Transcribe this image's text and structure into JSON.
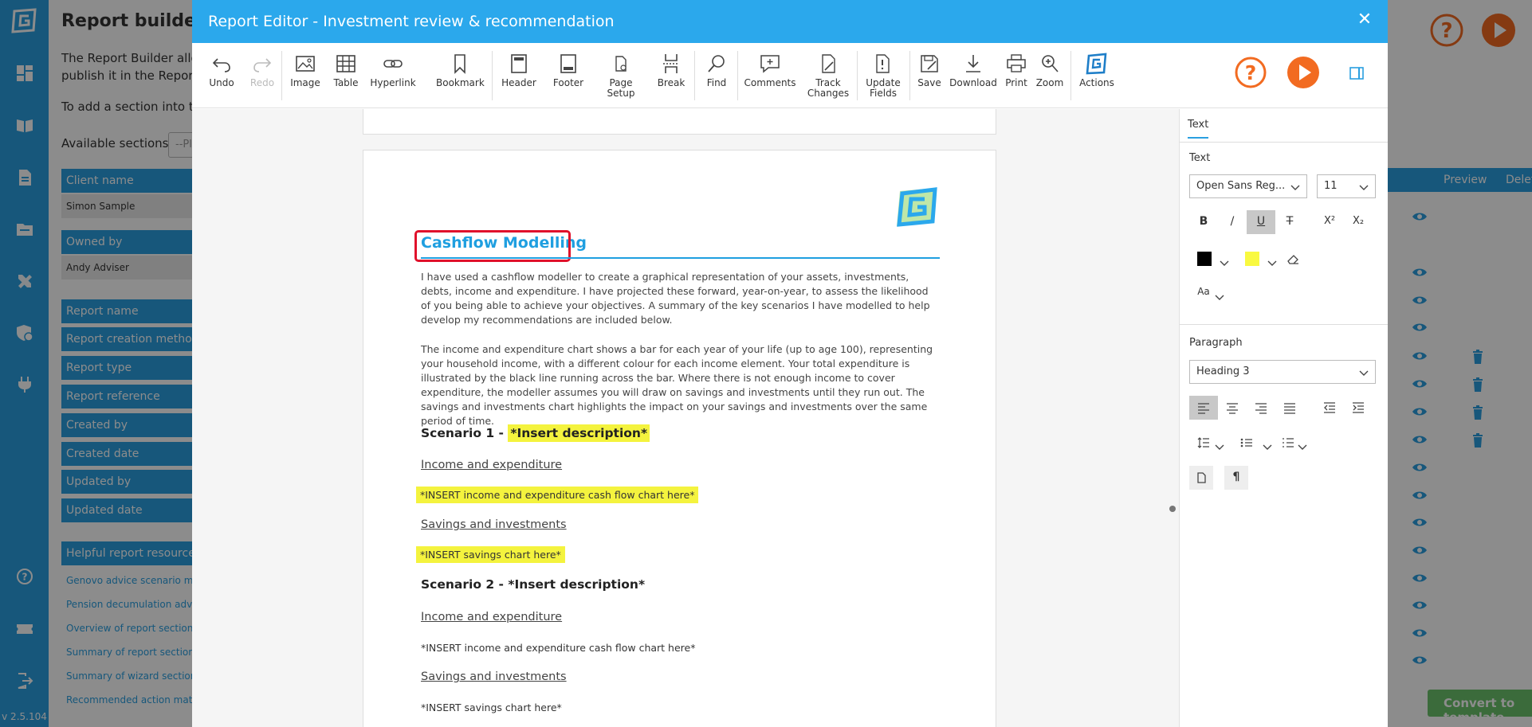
{
  "nav": {
    "version": "v 2.5.104",
    "icons": [
      "dashboard-icon",
      "book-icon",
      "document-icon",
      "folder-icon",
      "tools-icon",
      "shield-icon",
      "plug-icon",
      "help-icon",
      "ticket-icon",
      "logout-icon"
    ]
  },
  "background": {
    "title": "Report builder",
    "description": "The Report Builder allow publish it in the Report E",
    "add_section_text": "To add a section into the",
    "available_sections_label": "Available sections",
    "available_sections_placeholder": "--Pl",
    "fields": [
      {
        "label": "Client name",
        "value": "Simon Sample"
      },
      {
        "label": "Owned by",
        "value": "Andy Adviser"
      }
    ],
    "report_fields": [
      "Report name",
      "Report creation method",
      "Report type",
      "Report reference",
      "Created by",
      "Created date",
      "Updated by",
      "Updated date"
    ],
    "resources_header": "Helpful report resources",
    "resources": [
      "Genovo advice scenario matri",
      "Pension decumulation advice",
      "Overview of report sections",
      "Summary of report sections r",
      "Summary of wizard section st",
      "Recommended action matrix"
    ],
    "table_headers": {
      "preview": "Preview",
      "delete": "Delete"
    },
    "convert_button": "Convert to template"
  },
  "modal": {
    "title": "Report Editor - Investment review & recommendation",
    "close_symbol": "✕"
  },
  "toolbar": {
    "undo": "Undo",
    "redo": "Redo",
    "image": "Image",
    "table": "Table",
    "hyperlink": "Hyperlink",
    "bookmark": "Bookmark",
    "header": "Header",
    "footer": "Footer",
    "page_setup_1": "Page",
    "page_setup_2": "Setup",
    "break": "Break",
    "find": "Find",
    "comments": "Comments",
    "track_changes_1": "Track",
    "track_changes_2": "Changes",
    "update_fields_1": "Update",
    "update_fields_2": "Fields",
    "save": "Save",
    "download": "Download",
    "print": "Print",
    "zoom": "Zoom",
    "actions": "Actions"
  },
  "document": {
    "heading": "Cashflow Modelling",
    "para1": "I have used a cashflow modeller to create a graphical representation of your assets, investments, debts, income and expenditure. I have projected these forward, year-on-year, to assess the likelihood of you being able to achieve your objectives.  A summary of the key scenarios I have modelled to help develop my recommendations are included below.",
    "para2": "The income and expenditure chart shows a bar for each year of your life (up to age 100), representing your household income, with a different colour for each income element. Your total expenditure is illustrated by the black line running across the bar. Where there is not enough income to cover expenditure, the modeller assumes you will draw on savings and investments until they run out. The savings and investments chart highlights the impact on your savings and investments over the same period of time.",
    "scenario1_prefix": "Scenario 1 - ",
    "scenario1_desc": "*Insert description*",
    "income_expenditure_1": "Income and expenditure",
    "insert_ie_chart_1": "*INSERT income and expenditure cash flow chart here*",
    "savings_1": "Savings and investments",
    "insert_savings_1": "*INSERT savings chart here*",
    "scenario2": "Scenario 2 - *Insert description*",
    "income_expenditure_2": "Income and expenditure",
    "insert_ie_chart_2": "*INSERT income and expenditure cash flow chart here*",
    "savings_2": "Savings and investments",
    "insert_savings_2": "*INSERT savings chart here*"
  },
  "panel": {
    "tab": "Text",
    "text_label": "Text",
    "font_family": "Open Sans Reg...",
    "font_size": "11",
    "bold": "B",
    "italic": "/",
    "underline": "U",
    "strike": "T",
    "superscript": "X²",
    "subscript": "X₂",
    "font_color": "#000000",
    "highlight_color": "#f9f940",
    "case": "Aa",
    "paragraph_label": "Paragraph",
    "paragraph_style": "Heading 3",
    "pilcrow": "¶"
  },
  "colors": {
    "nav": "#2a9fe0",
    "title_bar": "#2ba8ec",
    "heading": "#1f9fe0",
    "highlight": "#f4f33e",
    "annotation": "#e0112b",
    "orange": "#f26b21"
  }
}
